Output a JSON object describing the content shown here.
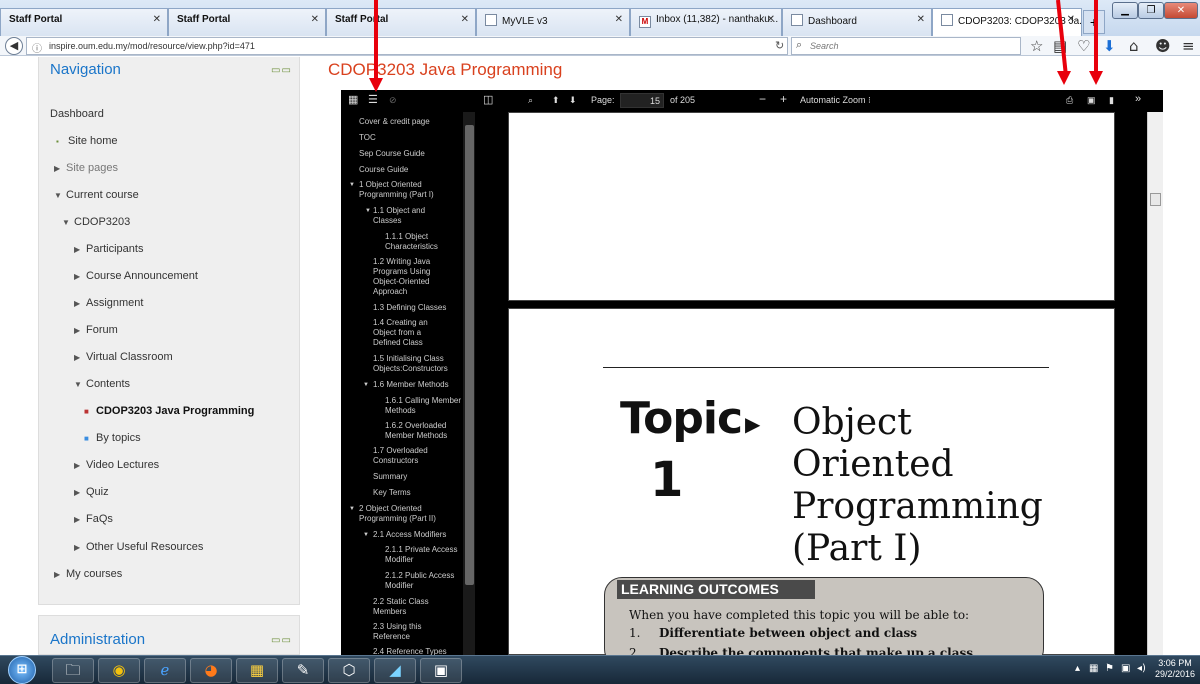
{
  "browser": {
    "tabs": [
      {
        "label": "Staff Portal",
        "bold": true,
        "icon": "none"
      },
      {
        "label": "Staff Portal",
        "icon": "none"
      },
      {
        "label": "Staff Portal",
        "icon": "none"
      },
      {
        "label": "MyVLE v3",
        "icon": "page-icon"
      },
      {
        "label": "Inbox (11,382) - nanthaku...",
        "icon": "gmail-icon"
      },
      {
        "label": "Dashboard",
        "icon": "page-icon"
      },
      {
        "label": "CDOP3203: CDOP3203 Ja...",
        "icon": "page-icon",
        "active": true
      }
    ],
    "new_tab": "+",
    "url": "inspire.oum.edu.my/mod/resource/view.php?id=471",
    "search_placeholder": "Search"
  },
  "sidebar": {
    "heading": "Navigation",
    "items": [
      {
        "label": "Dashboard"
      },
      {
        "label": "Site home"
      },
      {
        "label": "Site pages"
      },
      {
        "label": "Current course"
      },
      {
        "label": "CDOP3203"
      },
      {
        "label": "Participants"
      },
      {
        "label": "Course Announcement"
      },
      {
        "label": "Assignment"
      },
      {
        "label": "Forum"
      },
      {
        "label": "Virtual Classroom"
      },
      {
        "label": "Contents"
      },
      {
        "label": "CDOP3203 Java Programming"
      },
      {
        "label": "By topics"
      },
      {
        "label": "Video Lectures"
      },
      {
        "label": "Quiz"
      },
      {
        "label": "FaQs"
      },
      {
        "label": "Other Useful Resources"
      },
      {
        "label": "My courses"
      }
    ],
    "admin_heading": "Administration"
  },
  "document": {
    "title": "CDOP3203 Java Programming"
  },
  "pdf_toolbar": {
    "page_label": "Page:",
    "page_number": "15",
    "page_total": "of 205",
    "zoom": "Automatic Zoom"
  },
  "outline": [
    "Cover & credit page",
    "TOC",
    "Sep Course Guide",
    "Course Guide",
    "1 Object Oriented Programming (Part I)",
    "1.1 Object and Classes",
    "1.1.1 Object Characteristics",
    "1.2 Writing Java Programs Using Object-Oriented Approach",
    "1.3 Defining Classes",
    "1.4 Creating an Object from a Defined Class",
    "1.5 Initialising Class Objects:Constructors",
    "1.6 Member Methods",
    "1.6.1 Calling Member Methods",
    "1.6.2 Overloaded Member Methods",
    "1.7 Overloaded Constructors",
    "Summary",
    "Key Terms",
    "2 Object Oriented Programming (Part II)",
    "2.1 Access Modifiers",
    "2.1.1 Private Access Modifier",
    "2.1.2 Public Access Modifier",
    "2.2 Static Class Members",
    "2.3 Using this Reference",
    "2.4 Reference Types"
  ],
  "pdf_page": {
    "topic_word": "Topic",
    "topic_number": "1",
    "topic_title": "Object Oriented Programming (Part I)",
    "outcomes_heading": "LEARNING OUTCOMES",
    "outcomes_intro": "When you have completed this topic you will be able to:",
    "outcomes": [
      {
        "num": "1.",
        "text": "Differentiate between object and class"
      },
      {
        "num": "2.",
        "text": "Describe the components that make up a class"
      }
    ]
  },
  "taskbar": {
    "time": "3:06 PM",
    "date": "29/2/2016"
  },
  "colors": {
    "link": "#1a75c9",
    "title": "#d9411e",
    "arrow": "#e8000c"
  }
}
